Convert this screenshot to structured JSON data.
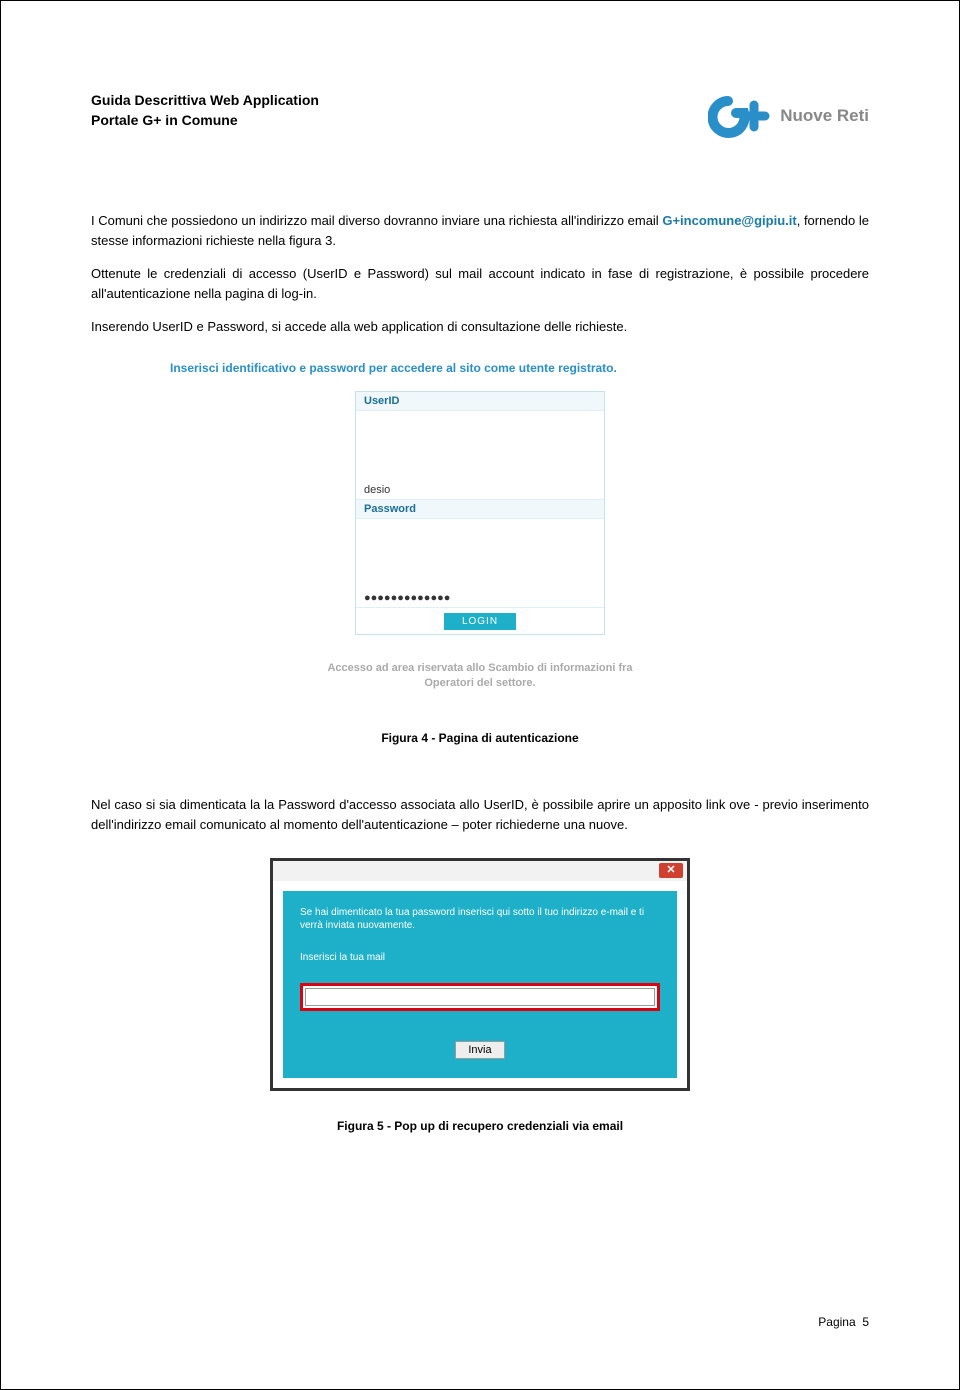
{
  "header": {
    "title_line1": "Guida Descrittiva Web Application",
    "title_line2": "Portale G+ in Comune",
    "logo_text": "Nuove Reti"
  },
  "body": {
    "para1_pre": "I Comuni che possiedono un indirizzo mail diverso dovranno inviare una richiesta all'indirizzo email ",
    "email": "G+incomune@gipiu.it",
    "para1_post": ", fornendo le stesse informazioni richieste nella figura 3.",
    "para2": "Ottenute le credenziali di accesso (UserID e Password) sul mail account indicato in fase di registrazione, è possibile procedere all'autenticazione nella pagina di log-in.",
    "para3": "Inserendo UserID e Password, si accede  alla web application di consultazione delle richieste.",
    "para4": "Nel caso si sia dimenticata la la Password d'accesso associata allo UserID,  è possibile aprire un apposito link ove - previo inserimento dell'indirizzo email comunicato al momento dell'autenticazione – poter richiederne una nuove."
  },
  "screenshot1": {
    "heading": "Inserisci identificativo e password per accedere al sito come utente registrato.",
    "userid_label": "UserID",
    "userid_value": "desio",
    "password_label": "Password",
    "password_value": "●●●●●●●●●●●●●",
    "login_button": "LOGIN",
    "footer_line1": "Accesso ad area riservata allo Scambio di informazioni fra",
    "footer_line2": "Operatori del settore."
  },
  "caption1": "Figura 4 - Pagina di autenticazione",
  "screenshot2": {
    "close_icon": "✕",
    "message": "Se hai dimenticato la tua password inserisci qui sotto il tuo indirizzo e-mail e ti verrà inviata nuovamente.",
    "input_label": "Inserisci la tua mail",
    "submit_button": "Invia"
  },
  "caption2": "Figura 5 - Pop up di recupero credenziali via email",
  "footer": {
    "page_label": "Pagina",
    "page_number": "5"
  }
}
